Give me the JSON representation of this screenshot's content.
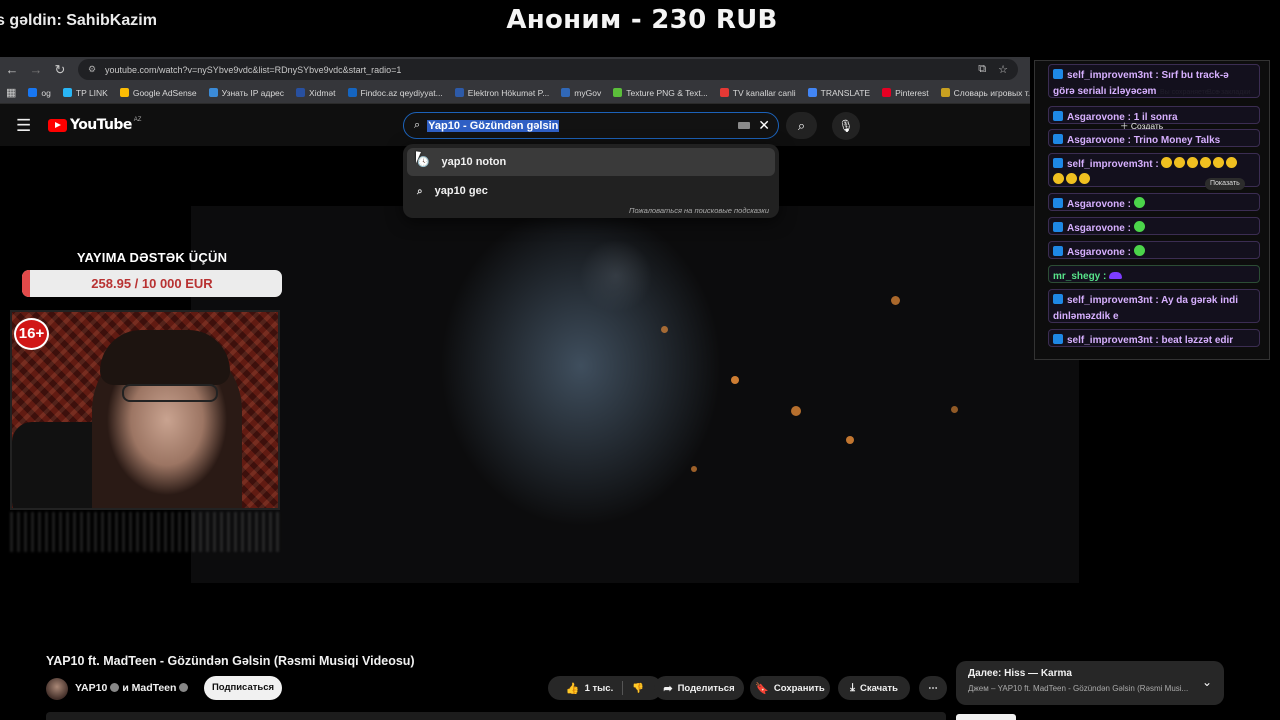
{
  "stream": {
    "welcome": "s gəldin: SahibKazim",
    "donation_alert": "Аноним - 230 RUB",
    "support_title": "YAYIMA DƏSTƏK ÜÇÜN",
    "support_progress": "258.95 / 10 000 EUR",
    "support_fraction": 0.025895,
    "age_badge": "16+"
  },
  "browser": {
    "url": "youtube.com/watch?v=nySYbve9vdc&list=RDnySYbve9vdc&start_radio=1",
    "bookmarks": [
      {
        "label": "og",
        "icon": "facebook-icon",
        "color": "#1877f2"
      },
      {
        "label": "TP LINK",
        "icon": "tplink-icon",
        "color": "#29b6f6"
      },
      {
        "label": "Google AdSense",
        "icon": "google-icon",
        "color": "#fbbc04"
      },
      {
        "label": "Узнать IP адрес",
        "icon": "ip-icon",
        "color": "#3b8bd8"
      },
      {
        "label": "Xidmət",
        "icon": "gov-icon",
        "color": "#2850a0"
      },
      {
        "label": "Findoc.az qeydiyyat...",
        "icon": "findoc-icon",
        "color": "#1565c0"
      },
      {
        "label": "Elektron Hökumət P...",
        "icon": "egov-icon",
        "color": "#2d5aa8"
      },
      {
        "label": "myGov",
        "icon": "mygov-icon",
        "color": "#3068b8"
      },
      {
        "label": "Texture PNG & Text...",
        "icon": "texture-icon",
        "color": "#5bbf3a"
      },
      {
        "label": "TV kanallar canli",
        "icon": "tv-icon",
        "color": "#e53935"
      },
      {
        "label": "TRANSLATE",
        "icon": "translate-icon",
        "color": "#4285f4"
      },
      {
        "label": "Pinterest",
        "icon": "pinterest-icon",
        "color": "#e60023"
      },
      {
        "label": "Словарь игровых т...",
        "icon": "shield-icon",
        "color": "#c8a020"
      }
    ]
  },
  "youtube": {
    "logo": "YouTube",
    "region": "AZ",
    "search_value": "Yap10 - Gözündən gəlsin",
    "suggestions": [
      "yap10 noton",
      "yap10 gec"
    ],
    "report_suggestions": "Пожаловаться на поисковые подсказки",
    "video_title": "YAP10 ft. MadTeen - Gözündən Gəlsin (Rəsmi Musiqi Videosu)",
    "channel": "YAP10",
    "channel_and": "и MadTeen",
    "subscribe": "Подписаться",
    "likes": "1 тыс.",
    "share": "Поделиться",
    "save": "Сохранить",
    "download": "Скачать",
    "up_next_label": "Далее: Hiss — Karma",
    "up_next_sub": "Джем – YAP10 ft. MadTeen - Gözündən Gəlsin (Rəsmi Musi..."
  },
  "chat": {
    "overlay_create": "Создать",
    "show_more": "Показать",
    "messages": [
      {
        "user": "self_improvem3nt",
        "text": "Sırf bu track-ə görə serialı izləyəcəm"
      },
      {
        "user": "Asgarovone",
        "text": "1 il sonra"
      },
      {
        "user": "Asgarovone",
        "text": "Trino Money Talks"
      },
      {
        "user": "self_improvem3nt",
        "text": ""
      },
      {
        "user": "Asgarovone",
        "text": ""
      },
      {
        "user": "Asgarovone",
        "text": ""
      },
      {
        "user": "Asgarovone",
        "text": ""
      },
      {
        "user": "mr_shegy",
        "text": ""
      },
      {
        "user": "self_improvem3nt",
        "text": "Ay da gərək indi dinləməzdik e"
      },
      {
        "user": "self_improvem3nt",
        "text": "beat ləzzət edir"
      }
    ]
  },
  "colors": {
    "youtube_red": "#ff0000",
    "chat_purple": "#d7b0ff",
    "chat_green": "#57e38a",
    "progress_red": "#e24a4a"
  }
}
